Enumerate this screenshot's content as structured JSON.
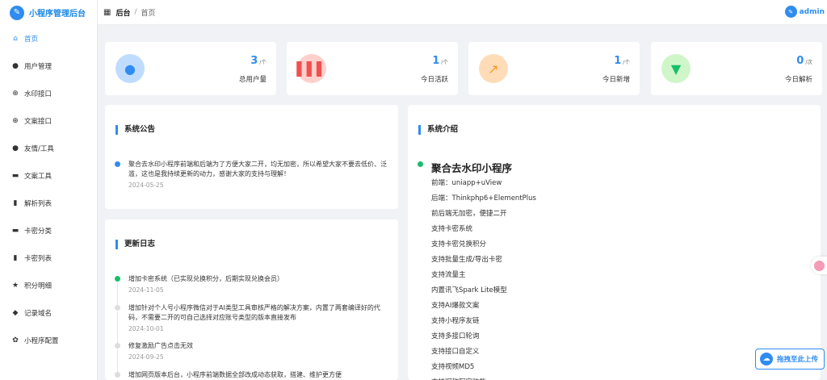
{
  "brand": {
    "title": "小程序管理后台",
    "logo_glyph": "✎"
  },
  "header": {
    "breadcrumb_root": "后台",
    "breadcrumb_sep": "/",
    "breadcrumb_current": "首页",
    "user_name": "admin"
  },
  "sidebar": {
    "items": [
      {
        "label": "首页",
        "icon": "home-icon",
        "glyph": "⌂",
        "active": true
      },
      {
        "label": "用户管理",
        "icon": "user-icon",
        "glyph": "●"
      },
      {
        "label": "水印接口",
        "icon": "plus-circle-icon",
        "glyph": "⊕"
      },
      {
        "label": "文案接口",
        "icon": "plus-circle-icon",
        "glyph": "⊕"
      },
      {
        "label": "友情/工具",
        "icon": "user-icon",
        "glyph": "●"
      },
      {
        "label": "文案工具",
        "icon": "message-icon",
        "glyph": "▬"
      },
      {
        "label": "解析列表",
        "icon": "clipboard-icon",
        "glyph": "▮"
      },
      {
        "label": "卡密分类",
        "icon": "message-icon",
        "glyph": "▬"
      },
      {
        "label": "卡密列表",
        "icon": "clipboard-icon",
        "glyph": "▮"
      },
      {
        "label": "积分明细",
        "icon": "star-icon",
        "glyph": "★"
      },
      {
        "label": "记录域名",
        "icon": "location-icon",
        "glyph": "◆"
      },
      {
        "label": "小程序配置",
        "icon": "gear-icon",
        "glyph": "✿"
      }
    ]
  },
  "stats": [
    {
      "value": "3",
      "unit": "/个",
      "label": "总用户量",
      "icon": "user-icon",
      "glyph": "●",
      "bg": "#bfdcff",
      "fg": "#2f8cf0"
    },
    {
      "value": "1",
      "unit": "/个",
      "label": "今日活跃",
      "icon": "bar-chart-icon",
      "glyph": "▌▌▌",
      "bg": "#ffd0cc",
      "fg": "#f05050"
    },
    {
      "value": "1",
      "unit": "/个",
      "label": "今日新增",
      "icon": "trend-icon",
      "glyph": "↗",
      "bg": "#ffdcb8",
      "fg": "#f59a23"
    },
    {
      "value": "0",
      "unit": "/次",
      "label": "今日解析",
      "icon": "brush-icon",
      "glyph": "▼",
      "bg": "#cff6c8",
      "fg": "#19be6b"
    }
  ],
  "announcement": {
    "title": "系统公告",
    "items": [
      {
        "text": "聚合去水印小程序前端和后端为了方便大家二开，均无加密，所以希望大家不要去低价、泛滥，这也是我持续更新的动力，感谢大家的支持与理解！",
        "date": "2024-05-25"
      }
    ]
  },
  "changelog": {
    "title": "更新日志",
    "items": [
      {
        "text": "增加卡密系统（已实现兑换积分，后期实现兑换会员）",
        "date": "2024-11-05"
      },
      {
        "text": "增加针对个人号小程序微信对于AI类型工具审核严格的解决方案，内置了两套编译好的代码，不需要二开的可自己选择对应账号类型的版本直接发布",
        "date": "2024-10-01"
      },
      {
        "text": "修复激励广告点击无效",
        "date": "2024-09-25"
      },
      {
        "text": "增加网页版本后台，小程序前端数据全部改成动态获取，搭建、维护更方便",
        "date": ""
      }
    ]
  },
  "intro": {
    "title": "系统介绍",
    "heading": "聚合去水印小程序",
    "lines": [
      "前端：uniapp+uView",
      "后端：Thinkphp6+ElementPlus",
      "前后端无加密，便捷二开",
      "支持卡密系统",
      "支持卡密兑换积分",
      "支持批量生成/导出卡密",
      "支持流量主",
      "内置讯飞Spark Lite模型",
      "支持AI爆款文案",
      "支持小程序友链",
      "支持多接口轮询",
      "支持接口自定义",
      "支持视频MD5",
      "支持昵称写字功能"
    ]
  },
  "float_button": {
    "label": "拖拽至此上传",
    "icon": "cloud-icon",
    "glyph": "☁"
  }
}
